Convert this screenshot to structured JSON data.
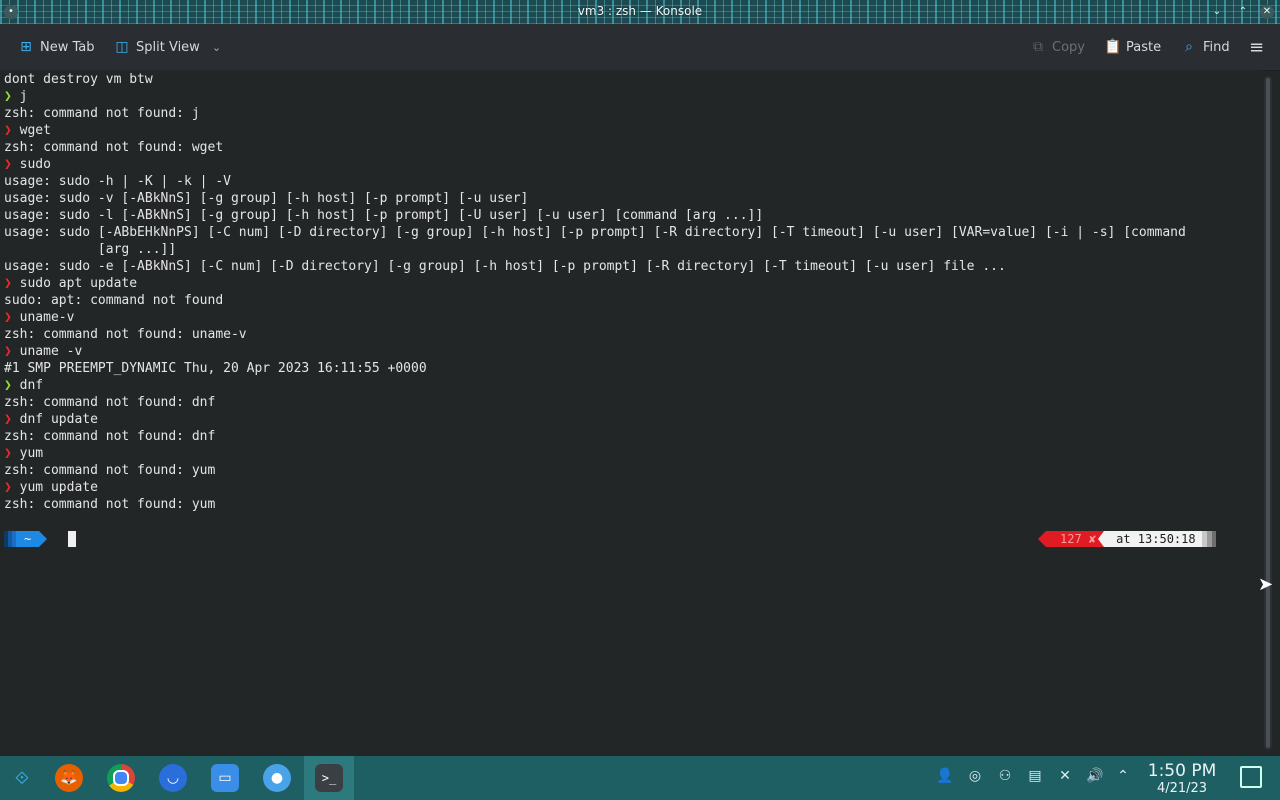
{
  "window": {
    "title": "vm3 : zsh — Konsole"
  },
  "toolbar": {
    "new_tab": "New Tab",
    "split_view": "Split View",
    "copy": "Copy",
    "paste": "Paste",
    "find": "Find"
  },
  "terminal": {
    "lines": [
      {
        "type": "out",
        "text": "dont destroy vm btw"
      },
      {
        "type": "cmd",
        "ok": true,
        "text": "j"
      },
      {
        "type": "out",
        "text": "zsh: command not found: j"
      },
      {
        "type": "cmd",
        "ok": false,
        "text": "wget"
      },
      {
        "type": "out",
        "text": "zsh: command not found: wget"
      },
      {
        "type": "cmd",
        "ok": false,
        "text": "sudo"
      },
      {
        "type": "out",
        "text": "usage: sudo -h | -K | -k | -V"
      },
      {
        "type": "out",
        "text": "usage: sudo -v [-ABkNnS] [-g group] [-h host] [-p prompt] [-u user]"
      },
      {
        "type": "out",
        "text": "usage: sudo -l [-ABkNnS] [-g group] [-h host] [-p prompt] [-U user] [-u user] [command [arg ...]]"
      },
      {
        "type": "out",
        "text": "usage: sudo [-ABbEHkNnPS] [-C num] [-D directory] [-g group] [-h host] [-p prompt] [-R directory] [-T timeout] [-u user] [VAR=value] [-i | -s] [command"
      },
      {
        "type": "out",
        "text": "            [arg ...]]"
      },
      {
        "type": "out",
        "text": "usage: sudo -e [-ABkNnS] [-C num] [-D directory] [-g group] [-h host] [-p prompt] [-R directory] [-T timeout] [-u user] file ..."
      },
      {
        "type": "cmd",
        "ok": false,
        "text": "sudo apt update"
      },
      {
        "type": "out",
        "text": "sudo: apt: command not found"
      },
      {
        "type": "cmd",
        "ok": false,
        "text": "uname-v"
      },
      {
        "type": "out",
        "text": "zsh: command not found: uname-v"
      },
      {
        "type": "cmd",
        "ok": false,
        "text": "uname -v"
      },
      {
        "type": "out",
        "text": "#1 SMP PREEMPT_DYNAMIC Thu, 20 Apr 2023 16:11:55 +0000"
      },
      {
        "type": "cmd",
        "ok": true,
        "text": "dnf"
      },
      {
        "type": "out",
        "text": "zsh: command not found: dnf"
      },
      {
        "type": "cmd",
        "ok": false,
        "text": "dnf update"
      },
      {
        "type": "out",
        "text": "zsh: command not found: dnf"
      },
      {
        "type": "cmd",
        "ok": false,
        "text": "yum"
      },
      {
        "type": "out",
        "text": "zsh: command not found: yum"
      },
      {
        "type": "cmd",
        "ok": false,
        "text": "yum update"
      },
      {
        "type": "out",
        "text": "zsh: command not found: yum"
      }
    ],
    "prompt_arrow": "❯",
    "prompt_dir": "~",
    "exit_status": "127 ✘",
    "time_label": "at 13:50:18"
  },
  "taskbar": {
    "apps": [
      "app-launcher",
      "firefox",
      "chrome",
      "discover",
      "dolphin",
      "system-settings",
      "konsole"
    ],
    "clock_time": "1:50 PM",
    "clock_date": "4/21/23"
  },
  "colors": {
    "terminal_bg": "#232627",
    "prompt_error": "#ef2929",
    "prompt_ok": "#8ae234",
    "accent": "#3daee9",
    "panel": "#1e5f63"
  }
}
